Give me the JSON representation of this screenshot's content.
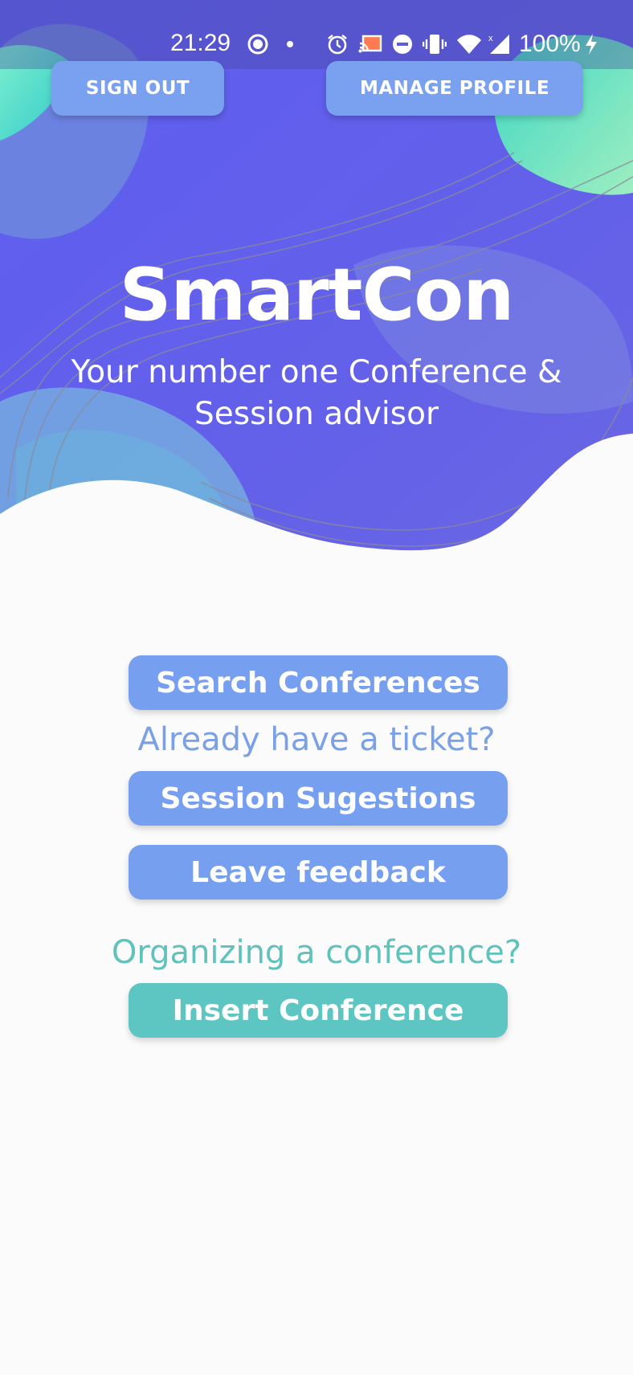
{
  "status_bar": {
    "time": "21:29",
    "battery": "100%",
    "icons": [
      "record-icon",
      "dot-icon",
      "alarm-icon",
      "cast-icon",
      "do-not-disturb-icon",
      "vibrate-icon",
      "wifi-icon",
      "signal-icon",
      "charging-icon"
    ]
  },
  "header": {
    "sign_out_label": "SIGN OUT",
    "manage_profile_label": "MANAGE PROFILE"
  },
  "hero": {
    "title": "SmartCon",
    "subtitle": "Your number one Conference & Session advisor"
  },
  "main": {
    "search_label": "Search Conferences",
    "ticket_prompt": "Already have a ticket?",
    "session_label": "Session Sugestions",
    "feedback_label": "Leave feedback",
    "organize_prompt": "Organizing a conference?",
    "insert_label": "Insert Conference"
  },
  "colors": {
    "hero_purple": "#6060ec",
    "hero_teal": "#4cdbc0",
    "button_blue": "#769ff0",
    "button_teal": "#5ec6c2",
    "prompt_blue": "#7aa0e6",
    "prompt_teal": "#60c2bb",
    "background": "#fbfbfb"
  }
}
